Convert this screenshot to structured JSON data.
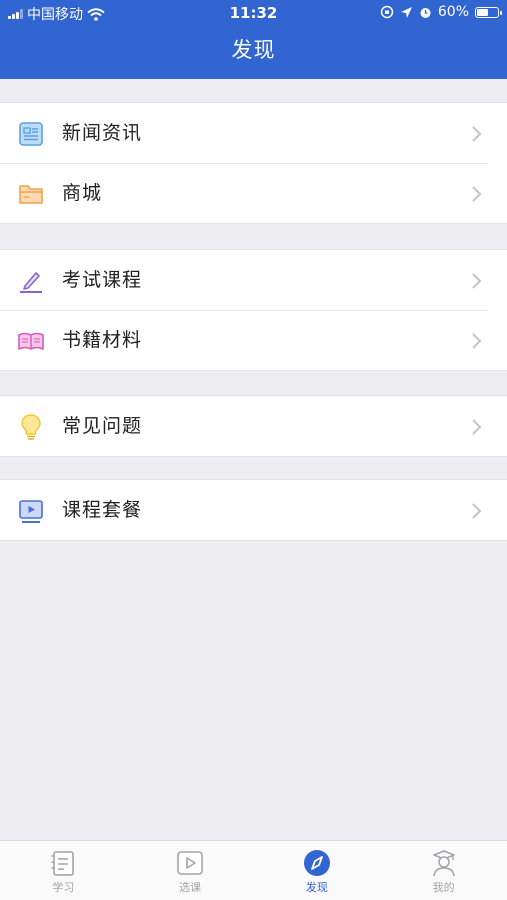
{
  "status_bar": {
    "carrier": "中国移动",
    "time": "11:32",
    "battery": "60%",
    "battery_level": 0.6
  },
  "header": {
    "title": "发现"
  },
  "groups": [
    {
      "items": [
        {
          "label": "新闻资讯",
          "icon": "newspaper-icon"
        },
        {
          "label": "商城",
          "icon": "folder-icon"
        }
      ]
    },
    {
      "items": [
        {
          "label": "考试课程",
          "icon": "pencil-icon"
        },
        {
          "label": "书籍材料",
          "icon": "open-book-icon"
        }
      ]
    },
    {
      "items": [
        {
          "label": "常见问题",
          "icon": "lightbulb-icon"
        }
      ]
    },
    {
      "items": [
        {
          "label": "课程套餐",
          "icon": "video-play-icon"
        }
      ]
    }
  ],
  "tab_bar": {
    "active": "发现",
    "tabs": [
      {
        "label": "学习",
        "icon": "notebook-icon"
      },
      {
        "label": "选课",
        "icon": "play-square-icon"
      },
      {
        "label": "发现",
        "icon": "compass-icon"
      },
      {
        "label": "我的",
        "icon": "graduate-avatar-icon"
      }
    ]
  },
  "colors": {
    "accent": "#3165d2",
    "background": "#eeeef2",
    "inactive_tab": "#a4a4a8"
  }
}
